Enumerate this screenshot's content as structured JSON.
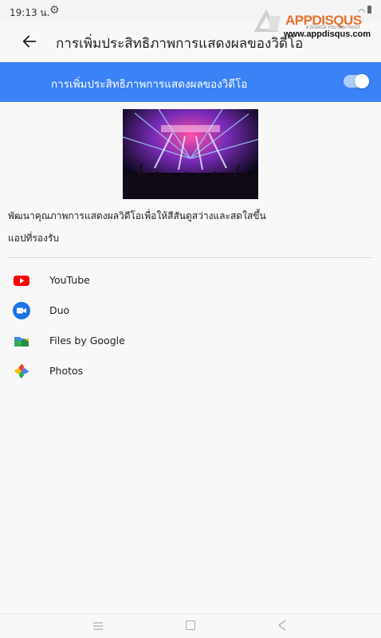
{
  "status_bar": {
    "time": "19:13 น.",
    "icons": [
      "gear-icon",
      "battery-icon"
    ]
  },
  "watermark": {
    "brand": "APPDISQUS",
    "tagline": "A SOURCE YOU CAN TRUST",
    "url": "www.appdisqus.com"
  },
  "header": {
    "title": "การเพิ่มประสิทธิภาพการแสดงผลของวิดีโอ",
    "back_icon": "arrow-left-icon"
  },
  "toggle": {
    "label": "การเพิ่มประสิทธิภาพการแสดงผลของวิดีโอ",
    "enabled": true,
    "accent": "#3b82f6"
  },
  "preview": {
    "icon": "concert-image"
  },
  "description": "พัฒนาคุณภาพการแสดงผลวิดีโอเพื่อให้สีสันดูสว่างและสดใสขึ้น",
  "supported_apps": {
    "heading": "แอปที่รองรับ",
    "items": [
      {
        "name": "YouTube",
        "icon": "youtube-icon"
      },
      {
        "name": "Duo",
        "icon": "duo-icon"
      },
      {
        "name": "Files by Google",
        "icon": "files-icon"
      },
      {
        "name": "Photos",
        "icon": "photos-icon"
      }
    ]
  },
  "nav_bar": {
    "icons": [
      "menu-icon",
      "home-icon",
      "back-icon"
    ]
  }
}
